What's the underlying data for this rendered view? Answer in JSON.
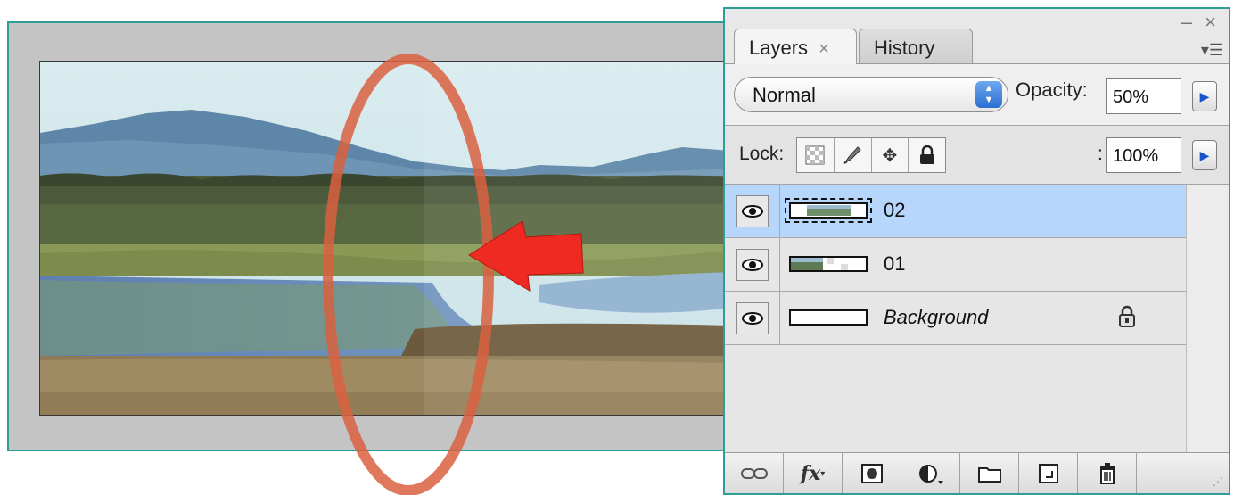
{
  "panel": {
    "window_controls": "– ×",
    "tabs": [
      {
        "label": "Layers",
        "close": "×",
        "active": true
      },
      {
        "label": "History",
        "active": false
      }
    ],
    "panel_menu_icon": "panel-menu-icon",
    "blend_mode": "Normal",
    "opacity_label": "Opacity:",
    "opacity_value": "50%",
    "lock_label": "Lock:",
    "lock_icons": [
      "lock-transparent-pixels-icon",
      "lock-image-pixels-icon",
      "lock-position-icon",
      "lock-all-icon"
    ],
    "fill_label": ":",
    "fill_value": "100%",
    "layers": [
      {
        "name": "02",
        "selected": true,
        "visible": true
      },
      {
        "name": "01",
        "selected": false,
        "visible": true
      },
      {
        "name": "Background",
        "selected": false,
        "visible": true,
        "locked": true
      }
    ],
    "bottom_buttons": [
      "link-layers-icon",
      "fx-icon",
      "layer-mask-icon",
      "adjustment-layer-icon",
      "group-folder-icon",
      "new-layer-icon",
      "trash-icon"
    ],
    "fx_label": "fx"
  },
  "annotations": {
    "highlight_color": "#d9603f",
    "arrow_color": "#ee2a22"
  }
}
